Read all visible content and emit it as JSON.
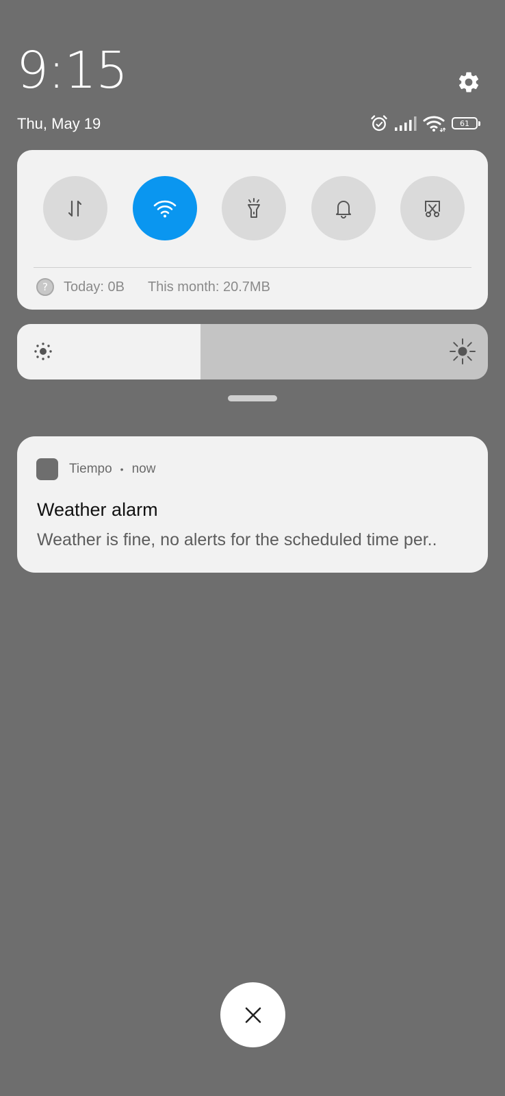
{
  "status_bar": {
    "time": "9:15",
    "date": "Thu, May 19",
    "battery_level": "61",
    "icons": [
      "alarm-icon",
      "signal-icon",
      "wifi-icon",
      "battery-icon"
    ]
  },
  "quick_settings": {
    "tiles": [
      {
        "name": "mobile-data",
        "icon": "data-arrows-icon",
        "active": false
      },
      {
        "name": "wifi",
        "icon": "wifi-icon",
        "active": true
      },
      {
        "name": "flashlight",
        "icon": "flashlight-icon",
        "active": false
      },
      {
        "name": "sound",
        "icon": "bell-icon",
        "active": false
      },
      {
        "name": "screenshot",
        "icon": "screenshot-icon",
        "active": false
      }
    ],
    "data_usage": {
      "today": "Today: 0B",
      "month": "This month: 20.7MB"
    }
  },
  "brightness": {
    "level": 0.39
  },
  "notification": {
    "app_name": "Tiempo",
    "separator": "•",
    "time": "now",
    "title": "Weather alarm",
    "body": "Weather is fine, no alerts for the scheduled time per.."
  },
  "colors": {
    "background": "#6e6e6e",
    "panel": "#f2f2f2",
    "accent": "#0a96f0",
    "tile_inactive": "#dadada"
  }
}
